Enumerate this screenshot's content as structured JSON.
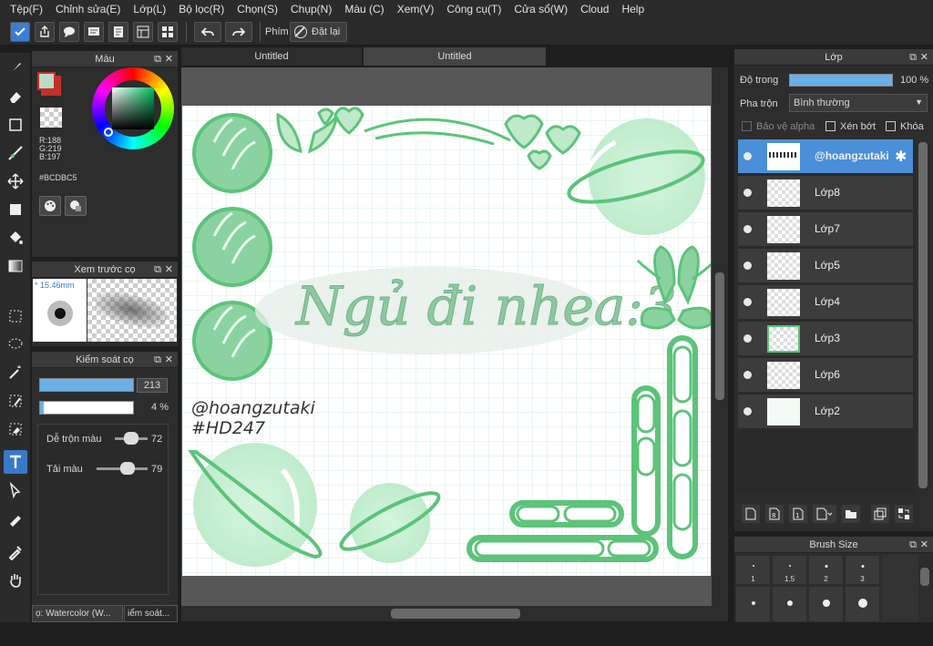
{
  "menu": [
    "Tệp(F)",
    "Chỉnh sửa(E)",
    "Lớp(L)",
    "Bộ lọc(R)",
    "Chọn(S)",
    "Chụp(N)",
    "Màu (C)",
    "Xem(V)",
    "Công cụ(T)",
    "Cửa sổ(W)",
    "Cloud",
    "Help"
  ],
  "toolbar": {
    "phim_label": "Phím",
    "reset_label": "Đặt lại"
  },
  "tabs": [
    "Untitled",
    "Untitled"
  ],
  "color_panel": {
    "title": "Màu",
    "r": "R:188",
    "g": "G:219",
    "b": "B:197",
    "hex": "#BCDBC5",
    "fg_color": "#BCDBC5",
    "bg_color": "#c4302b"
  },
  "brush_preview": {
    "title": "Xem trước cọ",
    "size": "15.46mm"
  },
  "brush_control": {
    "title": "Kiểm soát cọ",
    "size_value": "213",
    "opacity_value": "4 %",
    "blend_label": "Dễ trộn màu",
    "blend_value": "72",
    "reload_label": "Tải màu",
    "reload_value": "79",
    "bottom_tab1": "ọ: Watercolor (W...",
    "bottom_tab2": "iểm soát..."
  },
  "layers": {
    "title": "Lớp",
    "opacity_label": "Độ trong",
    "opacity_value": "100 %",
    "blend_label": "Pha trộn",
    "blend_value": "Bình thường",
    "protect_alpha": "Bảo vệ alpha",
    "clip": "Xén bớt",
    "lock": "Khóa",
    "items": [
      "@hoangzutaki",
      "Lớp8",
      "Lớp7",
      "Lớp5",
      "Lớp4",
      "Lớp3",
      "Lớp6",
      "Lớp2"
    ]
  },
  "brush_size": {
    "title": "Brush Size",
    "labels": [
      "1",
      "1.5",
      "2",
      "3"
    ]
  },
  "artwork": {
    "title": "Ngủ đi nhea:3",
    "handle": "@hoangzutaki",
    "tag": "#HD247",
    "accent": "#5cc37a"
  }
}
